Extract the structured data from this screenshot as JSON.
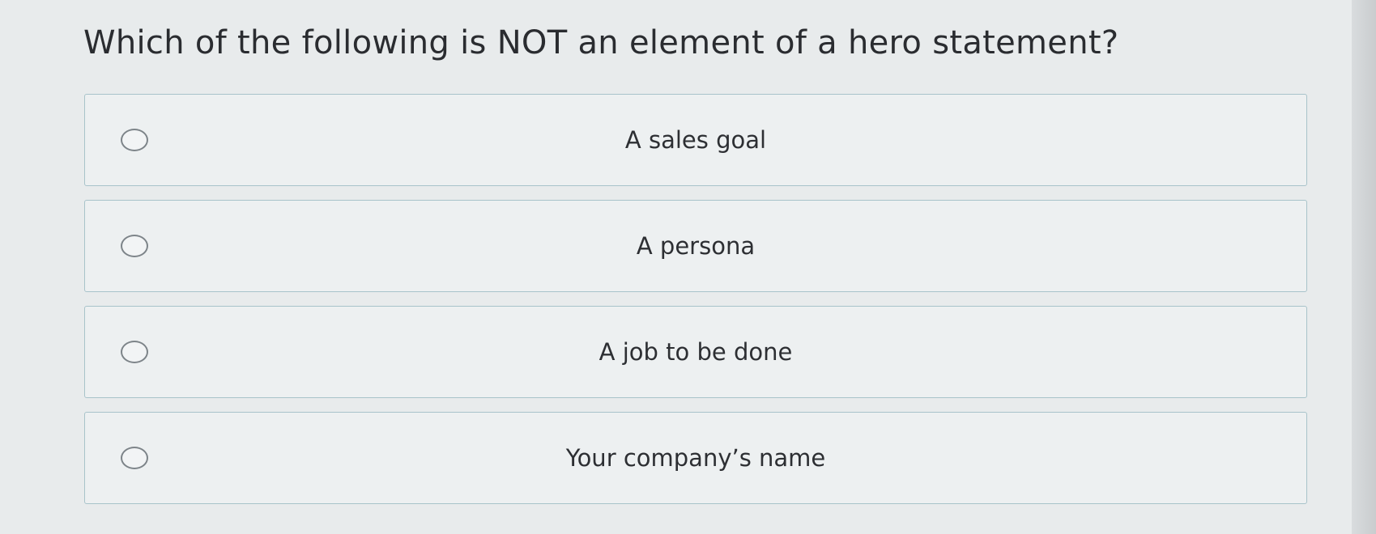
{
  "question": {
    "text": "Which of the following is NOT an element of a hero statement?"
  },
  "options": [
    {
      "label": "A sales goal",
      "icon": "radio-unselected-icon",
      "selected": false
    },
    {
      "label": "A persona",
      "icon": "radio-unselected-icon",
      "selected": false
    },
    {
      "label": "A job to be done",
      "icon": "radio-unselected-icon",
      "selected": false
    },
    {
      "label": "Your company’s name",
      "icon": "radio-unselected-icon",
      "selected": false
    }
  ],
  "colors": {
    "background": "#e8ebec",
    "option_border": "#a8c3ca",
    "option_background": "#edf0f1",
    "radio_border": "#7d8489",
    "text": "#2b2d31"
  }
}
